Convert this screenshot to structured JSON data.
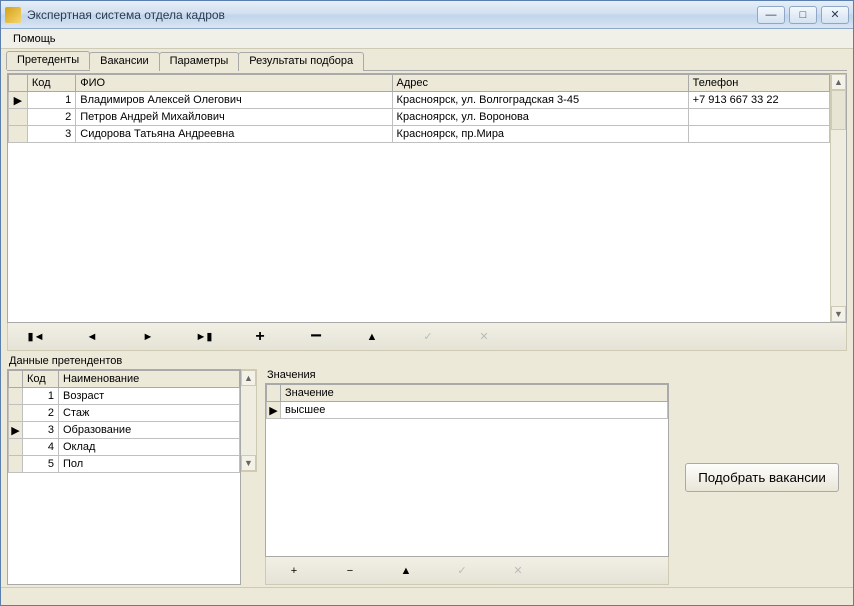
{
  "window": {
    "title": "Экспертная система отдела кадров"
  },
  "menu": {
    "help": "Помощь"
  },
  "tabs": [
    {
      "label": "Претеденты",
      "active": true
    },
    {
      "label": "Вакансии",
      "active": false
    },
    {
      "label": "Параметры",
      "active": false
    },
    {
      "label": "Результаты подбора",
      "active": false
    }
  ],
  "main_grid": {
    "columns": {
      "code": "Код",
      "fio": "ФИО",
      "address": "Адрес",
      "phone": "Телефон"
    },
    "rows": [
      {
        "code": "1",
        "fio": "Владимиров Алексей Олегович",
        "address": "Красноярск, ул. Волгоградская 3-45",
        "phone": "+7 913 667 33 22",
        "current": true
      },
      {
        "code": "2",
        "fio": "Петров Андрей Михайлович",
        "address": "Красноярск, ул. Воронова",
        "phone": "",
        "current": false
      },
      {
        "code": "3",
        "fio": "Сидорова Татьяна Андреевна",
        "address": "Красноярск, пр.Мира",
        "phone": "",
        "current": false
      }
    ]
  },
  "sections": {
    "details": "Данные претендентов",
    "values": "Значения"
  },
  "detail_grid": {
    "columns": {
      "code": "Код",
      "name": "Наименование"
    },
    "rows": [
      {
        "code": "1",
        "name": "Возраст",
        "current": false
      },
      {
        "code": "2",
        "name": "Стаж",
        "current": false
      },
      {
        "code": "3",
        "name": "Образование",
        "current": true
      },
      {
        "code": "4",
        "name": "Оклад",
        "current": false
      },
      {
        "code": "5",
        "name": "Пол",
        "current": false
      }
    ]
  },
  "values_grid": {
    "columns": {
      "value": "Значение"
    },
    "rows": [
      {
        "value": "высшее",
        "current": true
      }
    ]
  },
  "buttons": {
    "pick": "Подобрать вакансии"
  },
  "glyphs": {
    "first": "▮◀",
    "prev": "◀",
    "next": "▶",
    "last": "▶▮",
    "plus": "+",
    "minus": "−",
    "up": "▲",
    "check": "✓",
    "cancel": "✕",
    "row_current": "▶",
    "sb_up": "▲",
    "sb_down": "▼",
    "win_min": "—",
    "win_max": "□",
    "win_close": "✕"
  }
}
